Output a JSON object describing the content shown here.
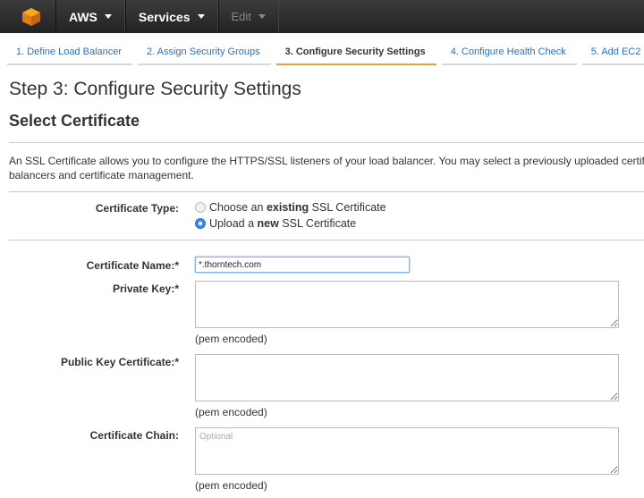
{
  "nav": {
    "aws_label": "AWS",
    "services_label": "Services",
    "edit_label": "Edit"
  },
  "tabs": [
    {
      "label": "1. Define Load Balancer"
    },
    {
      "label": "2. Assign Security Groups"
    },
    {
      "label": "3. Configure Security Settings"
    },
    {
      "label": "4. Configure Health Check"
    },
    {
      "label": "5. Add EC2"
    }
  ],
  "page": {
    "step_title": "Step 3: Configure Security Settings",
    "section_title": "Select Certificate",
    "description_line1": "An SSL Certificate allows you to configure the HTTPS/SSL listeners of your load balancer. You may select a previously uploaded certificate",
    "description_line2": "balancers and certificate management."
  },
  "form": {
    "certificate_type_label": "Certificate Type:",
    "option_existing_prefix": "Choose an ",
    "option_existing_bold": "existing",
    "option_existing_suffix": " SSL Certificate",
    "option_new_prefix": "Upload a ",
    "option_new_bold": "new",
    "option_new_suffix": " SSL Certificate",
    "certificate_name_label": "Certificate Name:*",
    "certificate_name_value": "*.thorntech.com",
    "private_key_label": "Private Key:*",
    "public_key_label": "Public Key Certificate:*",
    "certificate_chain_label": "Certificate Chain:",
    "certificate_chain_placeholder": "Optional",
    "pem_hint": "(pem encoded)"
  },
  "colors": {
    "accent": "#e2a33c",
    "link": "#2f6eb5",
    "nav_bg": "#2b2b2b"
  }
}
